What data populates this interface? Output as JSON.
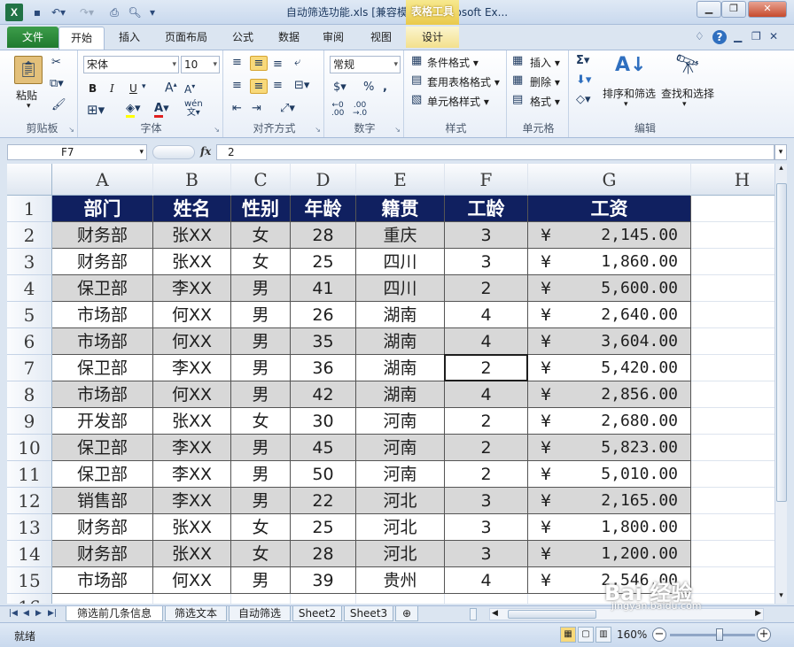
{
  "window": {
    "title": "自动筛选功能.xls  [兼容模式] - Microsoft Ex...",
    "context_tab": "表格工具"
  },
  "ribbon_tabs": [
    "文件",
    "开始",
    "插入",
    "页面布局",
    "公式",
    "数据",
    "审阅",
    "视图",
    "设计"
  ],
  "ribbon": {
    "clipboard": {
      "paste": "粘贴",
      "label": "剪贴板"
    },
    "font": {
      "name": "宋体",
      "size": "10",
      "label": "字体",
      "bold": "B",
      "italic": "I",
      "underline": "U"
    },
    "alignment": {
      "label": "对齐方式"
    },
    "number": {
      "format": "常规",
      "label": "数字"
    },
    "styles": {
      "conditional": "条件格式",
      "table_format": "套用表格格式",
      "cell_styles": "单元格样式",
      "label": "样式"
    },
    "cells": {
      "insert": "插入",
      "delete": "删除",
      "format": "格式",
      "label": "单元格"
    },
    "editing": {
      "sort_filter": "排序和筛选",
      "find_select": "查找和选择",
      "label": "编辑"
    }
  },
  "formula_bar": {
    "name_box": "F7",
    "fx": "fx",
    "value": "2"
  },
  "columns": [
    "A",
    "B",
    "C",
    "D",
    "E",
    "F",
    "G",
    "H"
  ],
  "rows": [
    "1",
    "2",
    "3",
    "4",
    "5",
    "6",
    "7",
    "8",
    "9",
    "10",
    "11",
    "12",
    "13",
    "14",
    "15",
    "16"
  ],
  "table": {
    "headers": [
      "部门",
      "姓名",
      "性别",
      "年龄",
      "籍贯",
      "工龄",
      "工资"
    ],
    "currency": "¥",
    "data": [
      [
        "财务部",
        "张XX",
        "女",
        "28",
        "重庆",
        "3",
        "2,145.00"
      ],
      [
        "财务部",
        "张XX",
        "女",
        "25",
        "四川",
        "3",
        "1,860.00"
      ],
      [
        "保卫部",
        "李XX",
        "男",
        "41",
        "四川",
        "2",
        "5,600.00"
      ],
      [
        "市场部",
        "何XX",
        "男",
        "26",
        "湖南",
        "4",
        "2,640.00"
      ],
      [
        "市场部",
        "何XX",
        "男",
        "35",
        "湖南",
        "4",
        "3,604.00"
      ],
      [
        "保卫部",
        "李XX",
        "男",
        "36",
        "湖南",
        "2",
        "5,420.00"
      ],
      [
        "市场部",
        "何XX",
        "男",
        "42",
        "湖南",
        "4",
        "2,856.00"
      ],
      [
        "开发部",
        "张XX",
        "女",
        "30",
        "河南",
        "2",
        "2,680.00"
      ],
      [
        "保卫部",
        "李XX",
        "男",
        "45",
        "河南",
        "2",
        "5,823.00"
      ],
      [
        "保卫部",
        "李XX",
        "男",
        "50",
        "河南",
        "2",
        "5,010.00"
      ],
      [
        "销售部",
        "李XX",
        "男",
        "22",
        "河北",
        "3",
        "2,165.00"
      ],
      [
        "财务部",
        "张XX",
        "女",
        "25",
        "河北",
        "3",
        "1,800.00"
      ],
      [
        "财务部",
        "张XX",
        "女",
        "28",
        "河北",
        "3",
        "1,200.00"
      ],
      [
        "市场部",
        "何XX",
        "男",
        "39",
        "贵州",
        "4",
        "2,546.00"
      ]
    ]
  },
  "sheets": [
    "筛选前几条信息",
    "筛选文本",
    "自动筛选",
    "Sheet2",
    "Sheet3"
  ],
  "status": {
    "text": "就绪",
    "zoom": "160%"
  },
  "watermark": {
    "main": "Bai 经验",
    "sub": "jingyan.baidu.com"
  }
}
